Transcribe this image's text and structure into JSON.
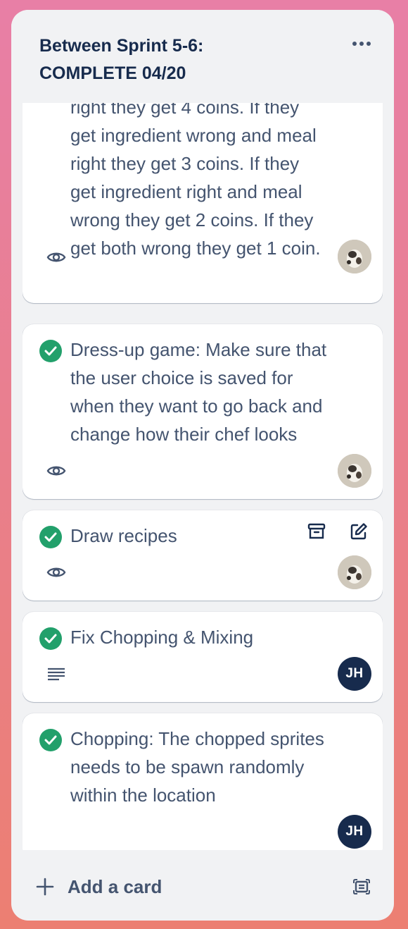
{
  "list": {
    "title": "Between Sprint 5-6:\nCOMPLETE 04/20",
    "footer": {
      "add_card_label": "Add a card"
    }
  },
  "cards": [
    {
      "text": "right they get 4 coins. If they\nget ingredient wrong and meal\nright they get 3 coins. If they\nget ingredient right and meal\nwrong they get 2 coins. If they\nget both wrong they get 1 coin.",
      "complete": false,
      "badge_icon": "eye-icon",
      "member": "photo-avatar"
    },
    {
      "text": "Dress-up game: Make sure that\nthe user choice is saved for\nwhen they want to go back and\nchange how their chef looks",
      "complete": true,
      "badge_icon": "eye-icon",
      "member": "photo-avatar"
    },
    {
      "text": "Draw recipes",
      "complete": true,
      "badge_icon": "eye-icon",
      "member": "photo-avatar",
      "hover_actions": [
        "archive-icon",
        "edit-icon"
      ]
    },
    {
      "text": "Fix Chopping & Mixing",
      "complete": true,
      "badge_icon": "description-icon",
      "member_initials": "JH"
    },
    {
      "text": "Chopping: The chopped sprites\nneeds to be spawn randomly\nwithin the location",
      "complete": true,
      "member_initials": "JH"
    }
  ],
  "colors": {
    "complete_green": "#22a06b",
    "list_bg": "#f1f2f4",
    "avatar_dark": "#172b4d",
    "text": "#44546f"
  }
}
